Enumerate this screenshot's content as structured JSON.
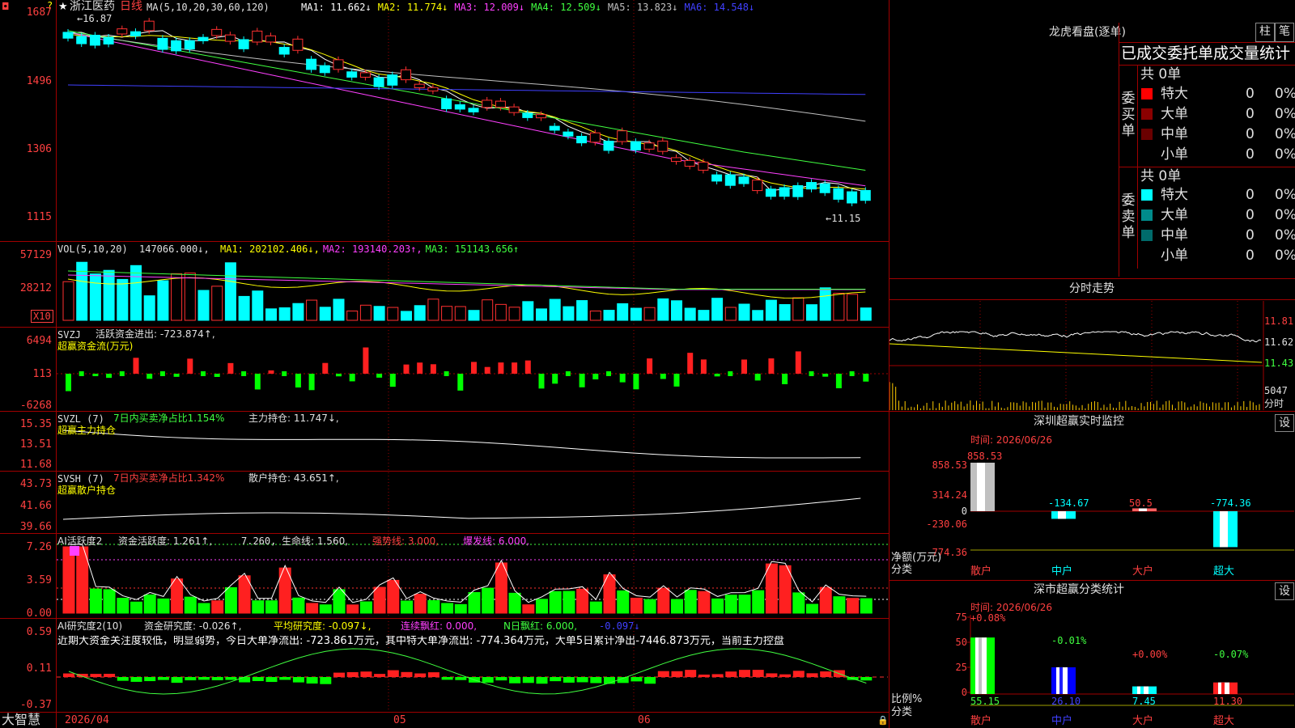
{
  "stock": {
    "name": "浙江医药",
    "period": "日线",
    "star": "★",
    "arrow_mark": "?",
    "high_mark": "←16.87",
    "low_mark": "←11.15"
  },
  "pane1": {
    "title": "MA(5,10,20,30,60,120)",
    "items": [
      {
        "label": "MA1: 11.662↓",
        "color": "#ffffff"
      },
      {
        "label": "MA2: 11.774↓",
        "color": "#ffff00"
      },
      {
        "label": "MA3: 12.009↓",
        "color": "#ff40ff"
      },
      {
        "label": "MA4: 12.509↓",
        "color": "#40ff40"
      },
      {
        "label": "MA5: 13.823↓",
        "color": "#c0c0c0"
      },
      {
        "label": "MA6: 14.548↓",
        "color": "#4040ff"
      }
    ],
    "y_labels": [
      "1687",
      "1496",
      "1306",
      "1115"
    ]
  },
  "pane2": {
    "title": "VOL(5,10,20)",
    "value": "147066.000↓,",
    "items": [
      {
        "label": "MA1: 202102.406↓,",
        "color": "#ffff00"
      },
      {
        "label": "MA2: 193140.203↑,",
        "color": "#ff40ff"
      },
      {
        "label": "MA3: 151143.656↑",
        "color": "#40ff40"
      }
    ],
    "y_labels": [
      "57129",
      "28212"
    ],
    "unit": "X10"
  },
  "pane3": {
    "title": "SVZJ",
    "label": "活跃资金进出: -723.874↑,",
    "sub": "超赢资金流(万元)",
    "y_labels": [
      "6494",
      "113",
      "-6268"
    ]
  },
  "pane4": {
    "title": "SVZL (7)",
    "ratio": "7日内买卖净占比1.154%",
    "hold": "主力持仓: 11.747↓,",
    "sub": "超赢主力持仓",
    "y_labels": [
      "15.35",
      "13.51",
      "11.68"
    ]
  },
  "pane5": {
    "title": "SVSH (7)",
    "ratio": "7日内买卖净占比1.342%",
    "hold": "散户持仓: 43.651↑,",
    "sub": "超赢散户持仓",
    "y_labels": [
      "43.73",
      "41.66",
      "39.66"
    ]
  },
  "pane6": {
    "title": "AI活跃度2",
    "a": "资金活跃度: 1.261↑,",
    "b": "7.260,",
    "c": "生命线: 1.560,",
    "d": "强势线: 3.000,",
    "e": "爆发线: 6.000,",
    "y_labels": [
      "7.26",
      "3.59",
      "0.00"
    ]
  },
  "pane7": {
    "title": "AI研究度2(10)",
    "a": "资金研究度: -0.026↑,",
    "b": "平均研究度: -0.097↓,",
    "c": "连续飘红: 0.000,",
    "d": "N日飘红: 6.000,",
    "e": "-0.097↓",
    "comment": "近期大资金关注度较低，明显弱势，今日大单净流出: -723.861万元，其中特大单净流出: -774.364万元，大单5日累计净出-7446.873万元，当前主力控盘",
    "y_labels": [
      "0.59",
      "0.11",
      "-0.37"
    ]
  },
  "xaxis": {
    "d1": "2026/04",
    "d2": "05",
    "d3": "06"
  },
  "brand": "大智慧",
  "right": {
    "lhb_title": "龙虎看盘(逐单)",
    "btn_bar": "柱",
    "btn_pen": "笔",
    "tabs": "已成交委托单成交量统计",
    "buy": {
      "side": "委买单",
      "total": "共 0单",
      "rows": [
        {
          "name": "特大",
          "count": "0",
          "pct": "0%",
          "color": "#ff0000"
        },
        {
          "name": "大单",
          "count": "0",
          "pct": "0%",
          "color": "#8b0000"
        },
        {
          "name": "中单",
          "count": "0",
          "pct": "0%",
          "color": "#6a0000"
        },
        {
          "name": "小单",
          "count": "0",
          "pct": "0%",
          "color": "#000000"
        }
      ]
    },
    "sell": {
      "side": "委卖单",
      "total": "共 0单",
      "rows": [
        {
          "name": "特大",
          "count": "0",
          "pct": "0%",
          "color": "#00ffff"
        },
        {
          "name": "大单",
          "count": "0",
          "pct": "0%",
          "color": "#008b8b"
        },
        {
          "name": "中单",
          "count": "0",
          "pct": "0%",
          "color": "#006b6b"
        },
        {
          "name": "小单",
          "count": "0",
          "pct": "0%",
          "color": "#000000"
        }
      ]
    },
    "intraday": {
      "title": "分时走势",
      "y": [
        "11.81",
        "11.62",
        "11.43"
      ],
      "vol": "5047",
      "unit": "分时"
    },
    "monitor": {
      "title": "深圳超赢实时监控",
      "btn": "设",
      "time": "时间: 2026/06/26",
      "y": [
        "858.53",
        "314.24",
        "0",
        "-230.06",
        "-774.36"
      ],
      "left_label1": "净额(万元)",
      "left_label2": "分类",
      "bars": [
        {
          "cat": "散户",
          "value": "858.53"
        },
        {
          "cat": "中户",
          "value": "-134.67"
        },
        {
          "cat": "大户",
          "value": "50.5"
        },
        {
          "cat": "超大",
          "value": "-774.36"
        }
      ]
    },
    "stat": {
      "title": "深市超赢分类统计",
      "btn": "设",
      "time": "时间: 2026/06/26",
      "y": [
        "75",
        "50",
        "25",
        "0"
      ],
      "left_label1": "比例%",
      "left_label2": "分类",
      "bars": [
        {
          "cat": "散户",
          "top": "+0.08%",
          "bottom": "55.15"
        },
        {
          "cat": "中户",
          "top": "-0.01%",
          "bottom": "26.10"
        },
        {
          "cat": "大户",
          "top": "+0.00%",
          "bottom": "7.45"
        },
        {
          "cat": "超大",
          "top": "-0.07%",
          "bottom": "11.30"
        }
      ]
    }
  }
}
